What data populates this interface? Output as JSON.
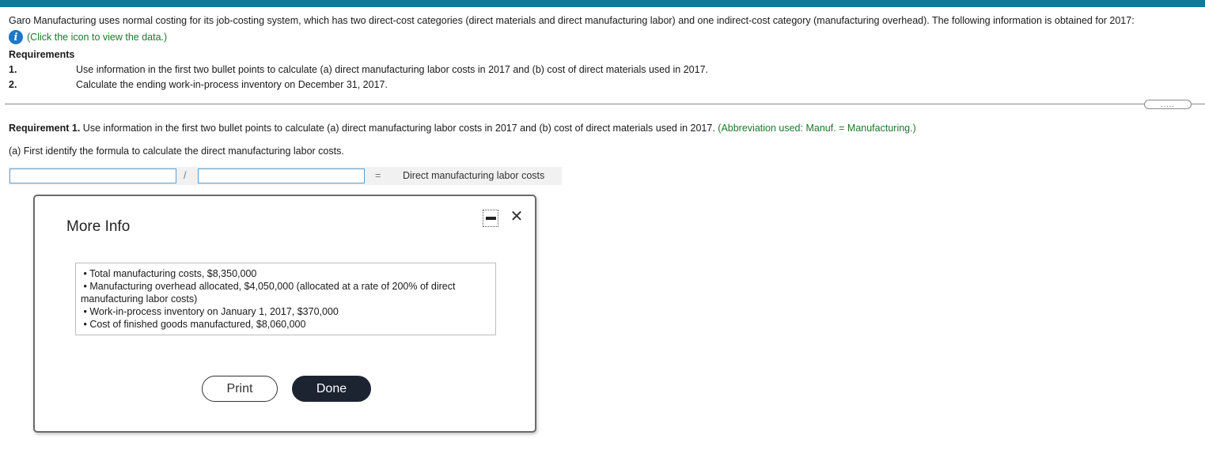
{
  "colors": {
    "top_bar": "#0e7a9c",
    "link_green": "#1a7a2a",
    "info_icon_blue": "#1e77c7",
    "input_border": "#5a9fcc",
    "done_button": "#1c2331"
  },
  "intro": {
    "text": "Garo Manufacturing uses normal costing for its job-costing system, which has two direct-cost categories (direct materials and direct manufacturing labor) and one indirect-cost category (manufacturing overhead). The following information is obtained for 2017:"
  },
  "data_link": {
    "icon": "info-icon",
    "icon_glyph": "i",
    "text": "(Click the icon to view the data.)"
  },
  "requirements": {
    "heading": "Requirements",
    "items": [
      {
        "num": "1.",
        "text": "Use information in the first two bullet points to calculate (a) direct manufacturing labor costs in 2017 and (b) cost of direct materials used in 2017."
      },
      {
        "num": "2.",
        "text": "Calculate the ending work-in-process inventory on December 31, 2017."
      }
    ]
  },
  "expand_pill": {
    "text": "....."
  },
  "requirement1": {
    "label": "Requirement 1.",
    "text": " Use information in the first two bullet points to calculate (a) direct manufacturing labor costs in 2017 and (b) cost of direct materials used in 2017. ",
    "note": "(Abbreviation used: Manuf. = Manufacturing.)"
  },
  "part_a": {
    "text": "(a) First identify the formula to calculate the direct manufacturing labor costs."
  },
  "formula": {
    "input1_value": "",
    "operator": "/",
    "input2_value": "",
    "equals": "=",
    "result": "Direct manufacturing labor costs"
  },
  "modal": {
    "title": "More Info",
    "minimize_icon": "minimize-icon",
    "close_icon": "close-icon",
    "close_glyph": "✕",
    "bullets": [
      "Total manufacturing costs, $8,350,000",
      "Manufacturing overhead allocated, $4,050,000 (allocated at a rate of 200% of direct manufacturing labor costs)",
      "Work-in-process inventory on January 1, 2017, $370,000",
      "Cost of finished goods manufactured, $8,060,000"
    ],
    "print_label": "Print",
    "done_label": "Done"
  }
}
